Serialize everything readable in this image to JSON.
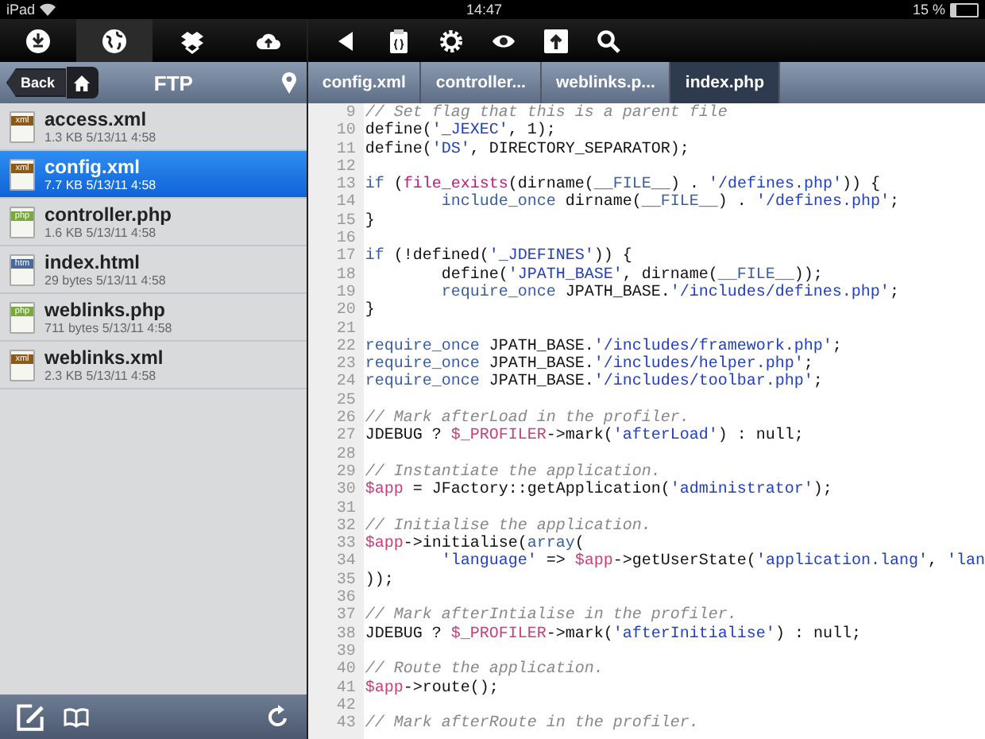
{
  "status_bar": {
    "device": "iPad",
    "time": "14:47",
    "battery": "15 %"
  },
  "left_toolbar": [
    {
      "selected": false
    },
    {
      "selected": true
    },
    {
      "selected": false
    },
    {
      "selected": false
    }
  ],
  "nav": {
    "back": "Back",
    "title": "FTP"
  },
  "files": [
    {
      "name": "access.xml",
      "meta": "1.3 KB 5/13/11 4:58",
      "type": "xml",
      "selected": false
    },
    {
      "name": "config.xml",
      "meta": "7.7 KB 5/13/11 4:58",
      "type": "xml",
      "selected": true
    },
    {
      "name": "controller.php",
      "meta": "1.6 KB 5/13/11 4:58",
      "type": "php",
      "selected": false
    },
    {
      "name": "index.html",
      "meta": "29 bytes 5/13/11 4:58",
      "type": "htm",
      "selected": false
    },
    {
      "name": "weblinks.php",
      "meta": "711 bytes 5/13/11 4:58",
      "type": "php",
      "selected": false
    },
    {
      "name": "weblinks.xml",
      "meta": "2.3 KB 5/13/11 4:58",
      "type": "xml",
      "selected": false
    }
  ],
  "tabs": [
    {
      "label": "config.xml",
      "selected": false
    },
    {
      "label": "controller...",
      "selected": false
    },
    {
      "label": "weblinks.p...",
      "selected": false
    },
    {
      "label": "index.php",
      "selected": true
    }
  ],
  "code": [
    {
      "number": "9",
      "tokens": [
        {
          "kind": "comment",
          "text": "// Set flag that this is a parent file"
        }
      ]
    },
    {
      "number": "10",
      "tokens": [
        {
          "kind": "plain",
          "text": "define("
        },
        {
          "kind": "string",
          "text": "'_JEXEC'"
        },
        {
          "kind": "plain",
          "text": ", 1);"
        }
      ]
    },
    {
      "number": "11",
      "tokens": [
        {
          "kind": "plain",
          "text": "define("
        },
        {
          "kind": "string",
          "text": "'DS'"
        },
        {
          "kind": "plain",
          "text": ", DIRECTORY_SEPARATOR);"
        }
      ]
    },
    {
      "number": "12"
    },
    {
      "number": "13",
      "tokens": [
        {
          "kind": "keyword",
          "text": "if"
        },
        {
          "kind": "plain",
          "text": " ("
        },
        {
          "kind": "func",
          "text": "file_exists"
        },
        {
          "kind": "plain",
          "text": "(dirname("
        },
        {
          "kind": "keyword",
          "text": "__FILE__"
        },
        {
          "kind": "plain",
          "text": ") . "
        },
        {
          "kind": "string",
          "text": "'/defines.php'"
        },
        {
          "kind": "plain",
          "text": ")) {"
        }
      ]
    },
    {
      "number": "14",
      "tokens": [
        {
          "kind": "keyword",
          "text": "        include_once"
        },
        {
          "kind": "plain",
          "text": " dirname("
        },
        {
          "kind": "keyword",
          "text": "__FILE__"
        },
        {
          "kind": "plain",
          "text": ") . "
        },
        {
          "kind": "string",
          "text": "'/defines.php'"
        },
        {
          "kind": "plain",
          "text": ";"
        }
      ]
    },
    {
      "number": "15",
      "tokens": [
        {
          "kind": "plain",
          "text": "}"
        }
      ]
    },
    {
      "number": "16"
    },
    {
      "number": "17",
      "tokens": [
        {
          "kind": "keyword",
          "text": "if"
        },
        {
          "kind": "plain",
          "text": " (!defined("
        },
        {
          "kind": "string",
          "text": "'_JDEFINES'"
        },
        {
          "kind": "plain",
          "text": ")) {"
        }
      ]
    },
    {
      "number": "18",
      "tokens": [
        {
          "kind": "plain",
          "text": "        define("
        },
        {
          "kind": "string",
          "text": "'JPATH_BASE'"
        },
        {
          "kind": "plain",
          "text": ", dirname("
        },
        {
          "kind": "keyword",
          "text": "__FILE__"
        },
        {
          "kind": "plain",
          "text": "));"
        }
      ]
    },
    {
      "number": "19",
      "tokens": [
        {
          "kind": "keyword",
          "text": "        require_once"
        },
        {
          "kind": "plain",
          "text": " JPATH_BASE."
        },
        {
          "kind": "string",
          "text": "'/includes/defines.php'"
        },
        {
          "kind": "plain",
          "text": ";"
        }
      ]
    },
    {
      "number": "20",
      "tokens": [
        {
          "kind": "plain",
          "text": "}"
        }
      ]
    },
    {
      "number": "21"
    },
    {
      "number": "22",
      "tokens": [
        {
          "kind": "keyword",
          "text": "require_once"
        },
        {
          "kind": "plain",
          "text": " JPATH_BASE."
        },
        {
          "kind": "string",
          "text": "'/includes/framework.php'"
        },
        {
          "kind": "plain",
          "text": ";"
        }
      ]
    },
    {
      "number": "23",
      "tokens": [
        {
          "kind": "keyword",
          "text": "require_once"
        },
        {
          "kind": "plain",
          "text": " JPATH_BASE."
        },
        {
          "kind": "string",
          "text": "'/includes/helper.php'"
        },
        {
          "kind": "plain",
          "text": ";"
        }
      ]
    },
    {
      "number": "24",
      "tokens": [
        {
          "kind": "keyword",
          "text": "require_once"
        },
        {
          "kind": "plain",
          "text": " JPATH_BASE."
        },
        {
          "kind": "string",
          "text": "'/includes/toolbar.php'"
        },
        {
          "kind": "plain",
          "text": ";"
        }
      ]
    },
    {
      "number": "25"
    },
    {
      "number": "26",
      "tokens": [
        {
          "kind": "comment",
          "text": "// Mark afterLoad in the profiler."
        }
      ]
    },
    {
      "number": "27",
      "tokens": [
        {
          "kind": "plain",
          "text": "JDEBUG ? "
        },
        {
          "kind": "var",
          "text": "$_PROFILER"
        },
        {
          "kind": "plain",
          "text": "->mark("
        },
        {
          "kind": "string",
          "text": "'afterLoad'"
        },
        {
          "kind": "plain",
          "text": ") : null;"
        }
      ]
    },
    {
      "number": "28"
    },
    {
      "number": "29",
      "tokens": [
        {
          "kind": "comment",
          "text": "// Instantiate the application."
        }
      ]
    },
    {
      "number": "30",
      "tokens": [
        {
          "kind": "var",
          "text": "$app"
        },
        {
          "kind": "plain",
          "text": " = JFactory::getApplication("
        },
        {
          "kind": "string",
          "text": "'administrator'"
        },
        {
          "kind": "plain",
          "text": ");"
        }
      ]
    },
    {
      "number": "31"
    },
    {
      "number": "32",
      "tokens": [
        {
          "kind": "comment",
          "text": "// Initialise the application."
        }
      ]
    },
    {
      "number": "33",
      "tokens": [
        {
          "kind": "var",
          "text": "$app"
        },
        {
          "kind": "plain",
          "text": "->initialise("
        },
        {
          "kind": "keyword",
          "text": "array"
        },
        {
          "kind": "plain",
          "text": "("
        }
      ]
    },
    {
      "number": "34",
      "tokens": [
        {
          "kind": "string",
          "text": "        'language'"
        },
        {
          "kind": "plain",
          "text": " => "
        },
        {
          "kind": "var",
          "text": "$app"
        },
        {
          "kind": "plain",
          "text": "->getUserState("
        },
        {
          "kind": "string",
          "text": "'application.lang'"
        },
        {
          "kind": "plain",
          "text": ", "
        },
        {
          "kind": "string",
          "text": "'lan"
        }
      ]
    },
    {
      "number": "35",
      "tokens": [
        {
          "kind": "plain",
          "text": "));"
        }
      ]
    },
    {
      "number": "36"
    },
    {
      "number": "37",
      "tokens": [
        {
          "kind": "comment",
          "text": "// Mark afterIntialise in the profiler."
        }
      ]
    },
    {
      "number": "38",
      "tokens": [
        {
          "kind": "plain",
          "text": "JDEBUG ? "
        },
        {
          "kind": "var",
          "text": "$_PROFILER"
        },
        {
          "kind": "plain",
          "text": "->mark("
        },
        {
          "kind": "string",
          "text": "'afterInitialise'"
        },
        {
          "kind": "plain",
          "text": ") : null;"
        }
      ]
    },
    {
      "number": "39"
    },
    {
      "number": "40",
      "tokens": [
        {
          "kind": "comment",
          "text": "// Route the application."
        }
      ]
    },
    {
      "number": "41",
      "tokens": [
        {
          "kind": "var",
          "text": "$app"
        },
        {
          "kind": "plain",
          "text": "->route();"
        }
      ]
    },
    {
      "number": "42"
    },
    {
      "number": "43",
      "tokens": [
        {
          "kind": "comment",
          "text": "// Mark afterRoute in the profiler."
        }
      ]
    }
  ]
}
